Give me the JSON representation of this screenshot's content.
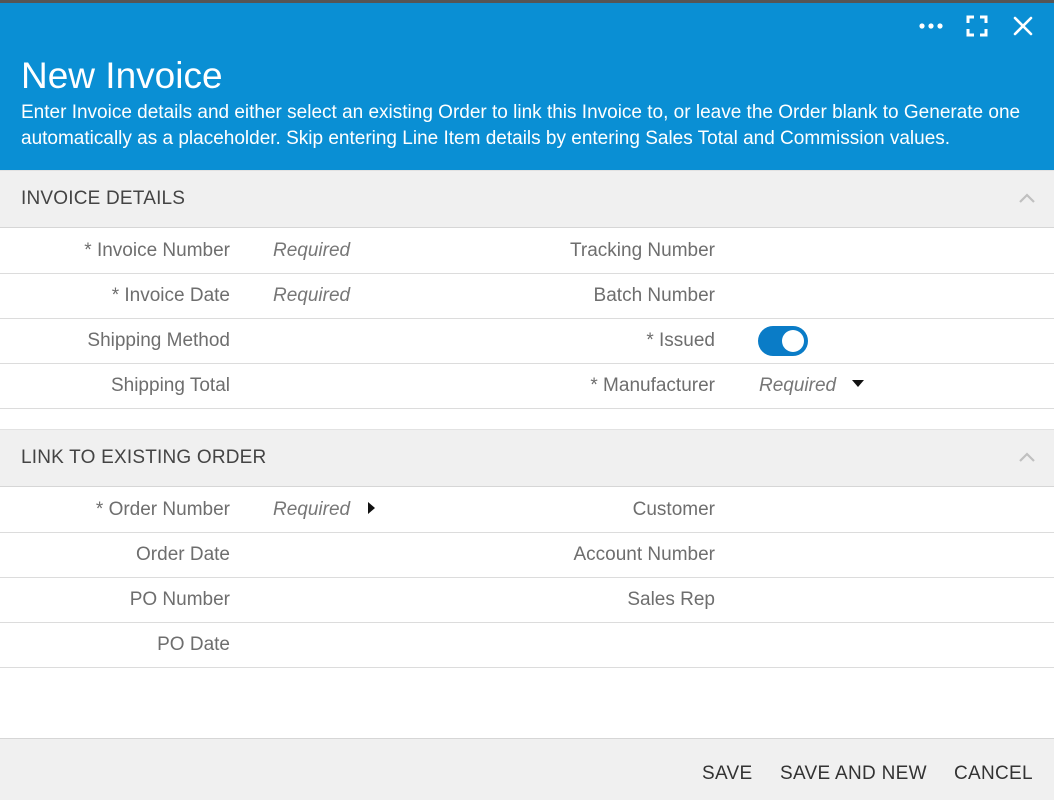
{
  "header": {
    "title": "New Invoice",
    "description": "Enter Invoice details and either select an existing Order to link this Invoice to, or leave the Order blank to Generate one automatically as a placeholder. Skip entering Line Item details by entering Sales Total and Commission values.",
    "background_color": "#0a8fd4",
    "icons": [
      "more-icon",
      "expand-icon",
      "close-icon"
    ]
  },
  "invoice_details": {
    "title": "INVOICE DETAILS",
    "rows": [
      {
        "left_label": "* Invoice Number",
        "left_value": "Required",
        "right_label": "Tracking Number",
        "right_value": ""
      },
      {
        "left_label": "* Invoice Date",
        "left_value": "Required",
        "right_label": "Batch Number",
        "right_value": ""
      },
      {
        "left_label": "Shipping Method",
        "left_value": "",
        "right_label": "* Issued",
        "right_value": ""
      },
      {
        "left_label": "Shipping Total",
        "left_value": "",
        "right_label": "* Manufacturer",
        "right_value": "Required"
      }
    ],
    "issued_toggle": {
      "on": true,
      "color": "#0a7cc7"
    }
  },
  "link_order": {
    "title": "LINK TO EXISTING ORDER",
    "rows": [
      {
        "left_label": "* Order Number",
        "left_value": "Required",
        "right_label": "Customer",
        "right_value": ""
      },
      {
        "left_label": "Order Date",
        "left_value": "",
        "right_label": "Account Number",
        "right_value": ""
      },
      {
        "left_label": "PO Number",
        "left_value": "",
        "right_label": "Sales Rep",
        "right_value": ""
      },
      {
        "left_label": "PO Date",
        "left_value": "",
        "right_label": "",
        "right_value": ""
      }
    ]
  },
  "footer": {
    "save": "SAVE",
    "save_and_new": "SAVE AND NEW",
    "cancel": "CANCEL"
  }
}
